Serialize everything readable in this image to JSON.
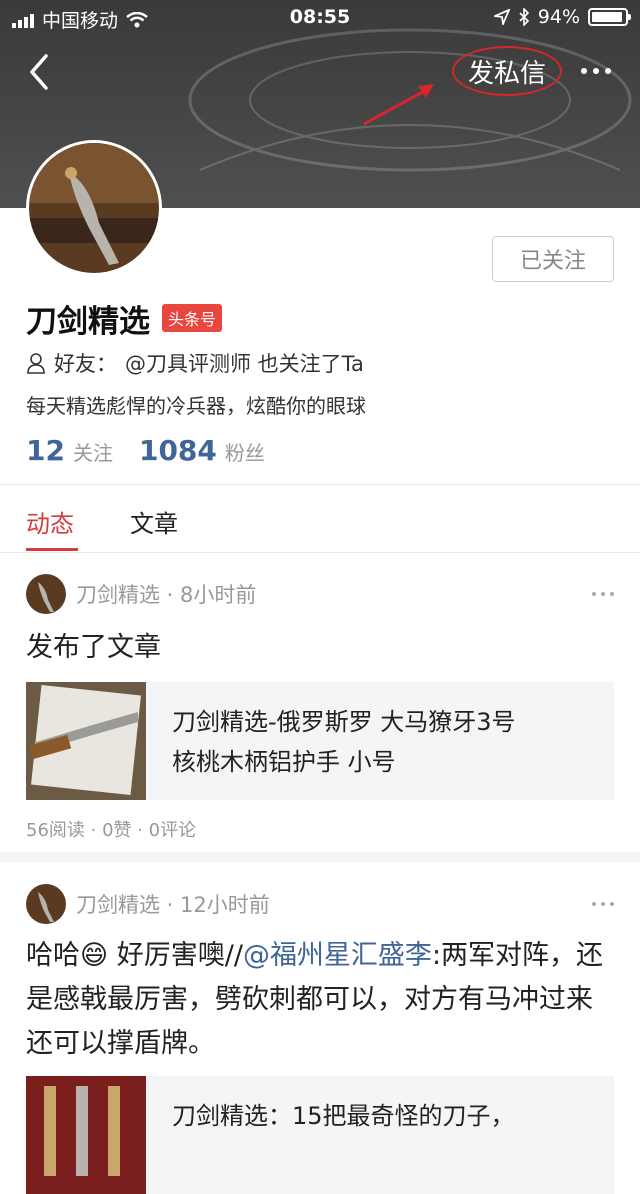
{
  "status_bar": {
    "carrier": "中国移动",
    "time": "08:55",
    "battery": "94%",
    "battery_level": 0.94
  },
  "header": {
    "message_button": "发私信",
    "arrow_color": "#d6262b"
  },
  "profile": {
    "follow_button": "已关注",
    "name": "刀剑精选",
    "badge": "头条号",
    "friends_prefix": "好友：",
    "friends_text": "@刀具评测师 也关注了Ta",
    "bio": "每天精选彪悍的冷兵器，炫酷你的眼球",
    "following_count": "12",
    "following_label": "关注",
    "followers_count": "1084",
    "followers_label": "粉丝"
  },
  "tabs": [
    {
      "label": "动态",
      "active": true
    },
    {
      "label": "文章",
      "active": false
    }
  ],
  "posts": [
    {
      "author": "刀剑精选",
      "time": "8小时前",
      "body": "发布了文章",
      "card_title_line1": "刀剑精选-俄罗斯罗 大马獠牙3号",
      "card_title_line2": "核桃木柄铝护手 小号",
      "stats": "56阅读 · 0赞 · 0评论"
    },
    {
      "author": "刀剑精选",
      "time": "12小时前",
      "body_prefix": "哈哈",
      "body_emoji": "😄",
      "body_text1": " 好厉害噢//",
      "body_mention": "@福州星汇盛李",
      "body_text2": ":两军对阵，还是感戟最厉害，劈砍刺都可以，对方有马冲过来还可以撑盾牌。",
      "card_title_line1": "刀剑精选：15把最奇怪的刀子，"
    }
  ],
  "colors": {
    "accent": "#d43d3d",
    "link": "#406599",
    "badge": "#e9463f"
  }
}
